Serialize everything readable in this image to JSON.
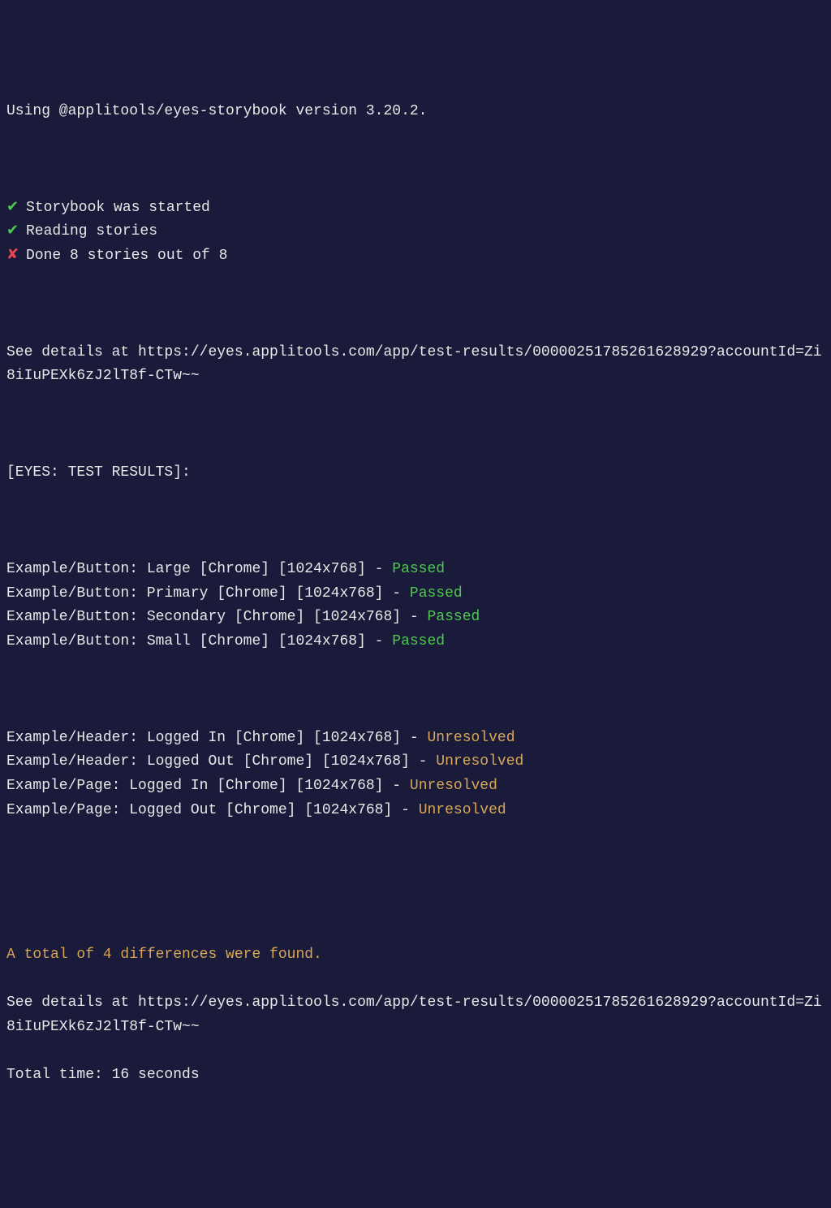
{
  "header": {
    "using_line": "Using @applitools/eyes-storybook version 3.20.2."
  },
  "status_lines": [
    {
      "icon": "check",
      "text": "Storybook was started"
    },
    {
      "icon": "check",
      "text": "Reading stories"
    },
    {
      "icon": "cross",
      "text": "Done 8 stories out of 8"
    }
  ],
  "details": {
    "prefix": "See details at ",
    "url": "https://eyes.applitools.com/app/test-results/00000251785261628929?accountId=Zi8iIuPEXk6zJ2lT8f-CTw~~"
  },
  "results_header": "[EYES: TEST RESULTS]:",
  "results_group1": [
    {
      "label": "Example/Button: Large [Chrome] [1024x768] - ",
      "status": "Passed",
      "status_type": "passed"
    },
    {
      "label": "Example/Button: Primary [Chrome] [1024x768] - ",
      "status": "Passed",
      "status_type": "passed"
    },
    {
      "label": "Example/Button: Secondary [Chrome] [1024x768] - ",
      "status": "Passed",
      "status_type": "passed"
    },
    {
      "label": "Example/Button: Small [Chrome] [1024x768] - ",
      "status": "Passed",
      "status_type": "passed"
    }
  ],
  "results_group2": [
    {
      "label": "Example/Header: Logged In [Chrome] [1024x768] - ",
      "status": "Unresolved",
      "status_type": "unresolved"
    },
    {
      "label": "Example/Header: Logged Out [Chrome] [1024x768] - ",
      "status": "Unresolved",
      "status_type": "unresolved"
    },
    {
      "label": "Example/Page: Logged In [Chrome] [1024x768] - ",
      "status": "Unresolved",
      "status_type": "unresolved"
    },
    {
      "label": "Example/Page: Logged Out [Chrome] [1024x768] - ",
      "status": "Unresolved",
      "status_type": "unresolved"
    }
  ],
  "footer": {
    "summary": "A total of 4 differences were found.",
    "details_prefix": "See details at ",
    "details_url": "https://eyes.applitools.com/app/test-results/00000251785261628929?accountId=Zi8iIuPEXk6zJ2lT8f-CTw~~",
    "total_time": "Total time: 16 seconds"
  },
  "icons": {
    "check": "✔",
    "cross": "✘"
  }
}
